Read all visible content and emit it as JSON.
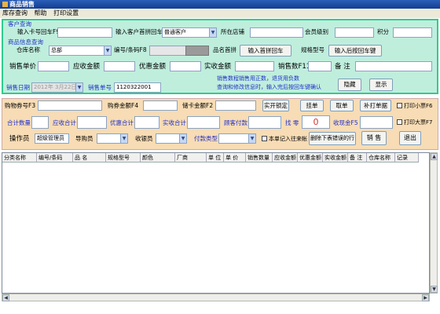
{
  "window": {
    "title": "商品销售"
  },
  "menu": [
    "库存查询",
    "帮助",
    "打印设置"
  ],
  "top": {
    "customer_title": "客户查询",
    "card_label": "输入卡号回车F9",
    "pinyin_label": "输入客户首拼回车",
    "customer_type": "普通客户",
    "store_label": "所在店铺",
    "level_label": "会员级别",
    "points_label": "积分",
    "goods_title": "商品信息查询",
    "warehouse_label": "仓库名称",
    "warehouse_value": "总部",
    "code_label": "编号/条码F8",
    "name_label": "品名首拼",
    "name_btn": "输入首拼回车",
    "spec_label": "规格型号",
    "spec_btn": "输入后按回车键",
    "unit_price_label": "销售单价",
    "receivable_label": "应收金额",
    "discount_label": "优惠金额",
    "paid_label": "实收金额",
    "qty_label": "销售数F11",
    "remark_label": "备 注",
    "date_label": "销售日期",
    "date_value": "2012年 3月22日",
    "order_label": "销售单号",
    "order_value": "1120322001",
    "note_line1": "销售数程销售用正数，退货用负数",
    "note_line2": "查询和修改信息时，输入完后按回车键确认",
    "hide_btn": "隐藏",
    "show_btn": "显示"
  },
  "mid": {
    "shop_card_label": "购物券号F3",
    "shop_amount_label": "购券金额F4",
    "card_amount_label": "储卡金额F2",
    "real_lock_btn": "实开锁定",
    "hang_btn": "挂单",
    "take_btn": "取单",
    "reprint_btn": "补打单据",
    "print_small": "打印小票F6",
    "total_qty_label": "合计数量",
    "total_receivable_label": "应收合计",
    "discount_total_label": "优惠合计",
    "paid_total_label": "实收合计",
    "customer_pay_label": "顾客付款",
    "change_label": "找 零",
    "change_value": "0",
    "received_label": "收现金F5",
    "print_big": "打印大票F7",
    "operator_label": "操作员",
    "operator_value": "超级管理员",
    "salesman_label": "导购员",
    "cashier_label": "收银员",
    "pay_type_label": "付款类型",
    "record_label": "本单记入往来帐",
    "delete_btn": "删除下表错误的行",
    "sell_btn": "销 售",
    "exit_btn": "退出"
  },
  "grid": {
    "columns": [
      "分类名称",
      "编号/条码",
      "品 名",
      "规格型号",
      "颜色",
      "厂商",
      "单 位",
      "单 价",
      "销售数量",
      "应收金额",
      "优惠金额",
      "实收金额",
      "备 注",
      "仓库名称",
      "记录"
    ]
  },
  "icons": {
    "scroll_up": "▲",
    "scroll_down": "▼",
    "scroll_left": "◀",
    "scroll_right": "▶",
    "dropdown": "▼"
  }
}
